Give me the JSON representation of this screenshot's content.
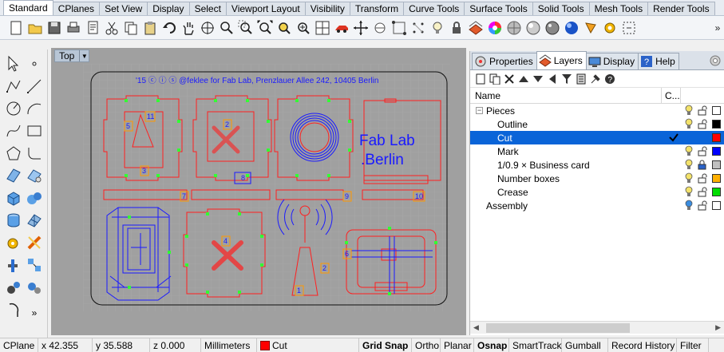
{
  "tabs": [
    "Standard",
    "CPlanes",
    "Set View",
    "Display",
    "Select",
    "Viewport Layout",
    "Visibility",
    "Transform",
    "Curve Tools",
    "Surface Tools",
    "Solid Tools",
    "Mesh Tools",
    "Render Tools"
  ],
  "active_tab": "Standard",
  "toolbar_overflow": "»",
  "sidebar_overflow": "»",
  "viewport": {
    "name": "Top",
    "dropdown_glyph": "▼",
    "engraving": "'15 ⓒ ⓘ ⓢ @feklee for Fab Lab, Prenzlauer Allee 242, 10405 Berlin",
    "logo_line1": "Fab Lab",
    "logo_line2": ".Berlin",
    "part_numbers": [
      "11",
      "2",
      "5",
      "3",
      "8",
      "7",
      "9",
      "10",
      "4",
      "6",
      "2",
      "1"
    ]
  },
  "panel": {
    "tabs": [
      {
        "label": "Properties",
        "icon": "properties-icon"
      },
      {
        "label": "Layers",
        "icon": "layers-icon"
      },
      {
        "label": "Display",
        "icon": "display-icon"
      },
      {
        "label": "Help",
        "icon": "help-icon"
      }
    ],
    "active_tab": "Layers",
    "columns": {
      "name": "Name",
      "c": "C..."
    },
    "layers": [
      {
        "name": "Pieces",
        "level": 0,
        "expanded": true,
        "expander": "−",
        "bulb": "#f3e26a",
        "lock": "open",
        "color": "#ffffff",
        "current": false
      },
      {
        "name": "Outline",
        "level": 1,
        "bulb": "#f3e26a",
        "lock": "open",
        "color": "#000000",
        "current": false
      },
      {
        "name": "Cut",
        "level": 1,
        "bulb": "",
        "lock": "",
        "color": "#ff0000",
        "current": true,
        "selected": true
      },
      {
        "name": "Mark",
        "level": 1,
        "bulb": "#f3e26a",
        "lock": "open",
        "color": "#0000ff",
        "current": false
      },
      {
        "name": "1/0.9 × Business card",
        "level": 1,
        "bulb": "#f3e26a",
        "lock": "closed",
        "color": "#c0c0c0",
        "current": false
      },
      {
        "name": "Number boxes",
        "level": 1,
        "bulb": "#f3e26a",
        "lock": "open",
        "color": "#ffb000",
        "current": false
      },
      {
        "name": "Crease",
        "level": 1,
        "bulb": "#f3e26a",
        "lock": "open",
        "color": "#00dd00",
        "current": false
      },
      {
        "name": "Assembly",
        "level": 0,
        "bulb": "#3a8de0",
        "lock": "open",
        "color": "#ffffff",
        "current": false
      }
    ]
  },
  "status": {
    "cplane": "CPlane",
    "x": "x 42.355",
    "y": "y 35.588",
    "z": "z 0.000",
    "units": "Millimeters",
    "layer": "Cut",
    "layer_color": "#ff0000",
    "toggles": [
      {
        "label": "Grid Snap",
        "active": true
      },
      {
        "label": "Ortho",
        "active": false
      },
      {
        "label": "Planar",
        "active": false
      },
      {
        "label": "Osnap",
        "active": true
      },
      {
        "label": "SmartTrack",
        "active": false
      },
      {
        "label": "Gumball",
        "active": false
      },
      {
        "label": "Record History",
        "active": false
      },
      {
        "label": "Filter",
        "active": false
      }
    ]
  },
  "colors": {
    "cut": "#ff2020",
    "mark": "#1a1aff",
    "crease": "#33ff33",
    "viewport_bg": "#a0a0a0",
    "grid": "#b0b0b0",
    "selection": "#0a64d8"
  }
}
